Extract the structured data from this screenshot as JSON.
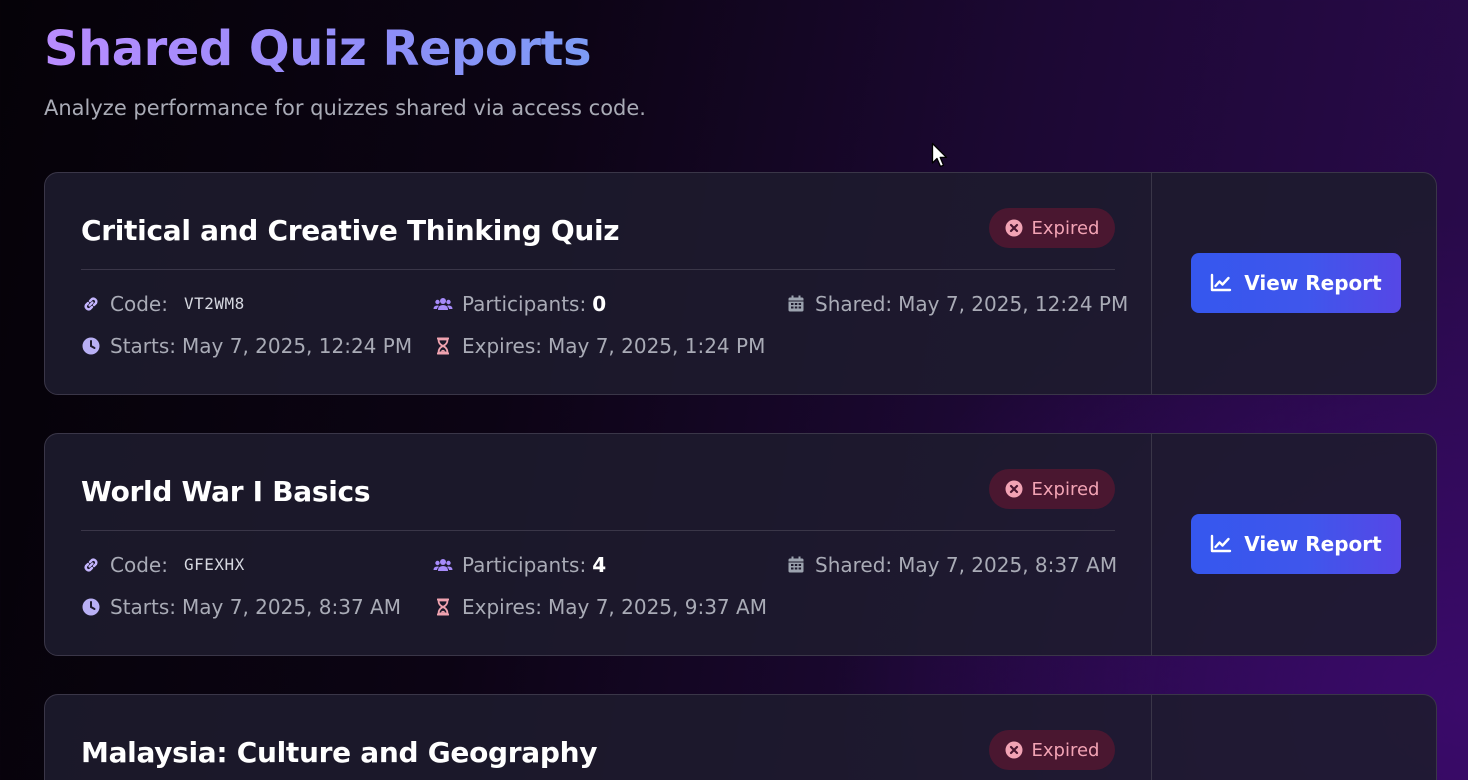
{
  "header": {
    "title": "Shared Quiz Reports",
    "subtitle": "Analyze performance for quizzes shared via access code."
  },
  "labels": {
    "code": "Code:",
    "participants": "Participants:",
    "shared": "Shared:",
    "starts": "Starts:",
    "expires": "Expires:",
    "view_report": "View Report"
  },
  "colors": {
    "accent": "#3b55ec",
    "expired_badge_bg": "#4a1730",
    "expired_badge_text": "#f2a3b4",
    "participants_icon": "#a78bfa",
    "expires_icon": "#f0a3b0",
    "link_icon": "#c4b5fd",
    "clock_icon": "#b9b0f5",
    "calendar_icon": "#9ca3af"
  },
  "icons": {
    "code": "link-icon",
    "participants": "users-icon",
    "shared": "calendar-icon",
    "starts": "clock-icon",
    "expires": "hourglass-icon",
    "status": "x-circle-icon",
    "report": "chart-line-icon"
  },
  "quizzes": [
    {
      "title": "Critical and Creative Thinking Quiz",
      "status": "Expired",
      "code": "VT2WM8",
      "participants": "0",
      "shared": "May 7, 2025, 12:24 PM",
      "starts": "May 7, 2025, 12:24 PM",
      "expires": "May 7, 2025, 1:24 PM"
    },
    {
      "title": "World War I Basics",
      "status": "Expired",
      "code": "GFEXHX",
      "participants": "4",
      "shared": "May 7, 2025, 8:37 AM",
      "starts": "May 7, 2025, 8:37 AM",
      "expires": "May 7, 2025, 9:37 AM"
    },
    {
      "title": "Malaysia: Culture and Geography",
      "status": "Expired"
    }
  ]
}
